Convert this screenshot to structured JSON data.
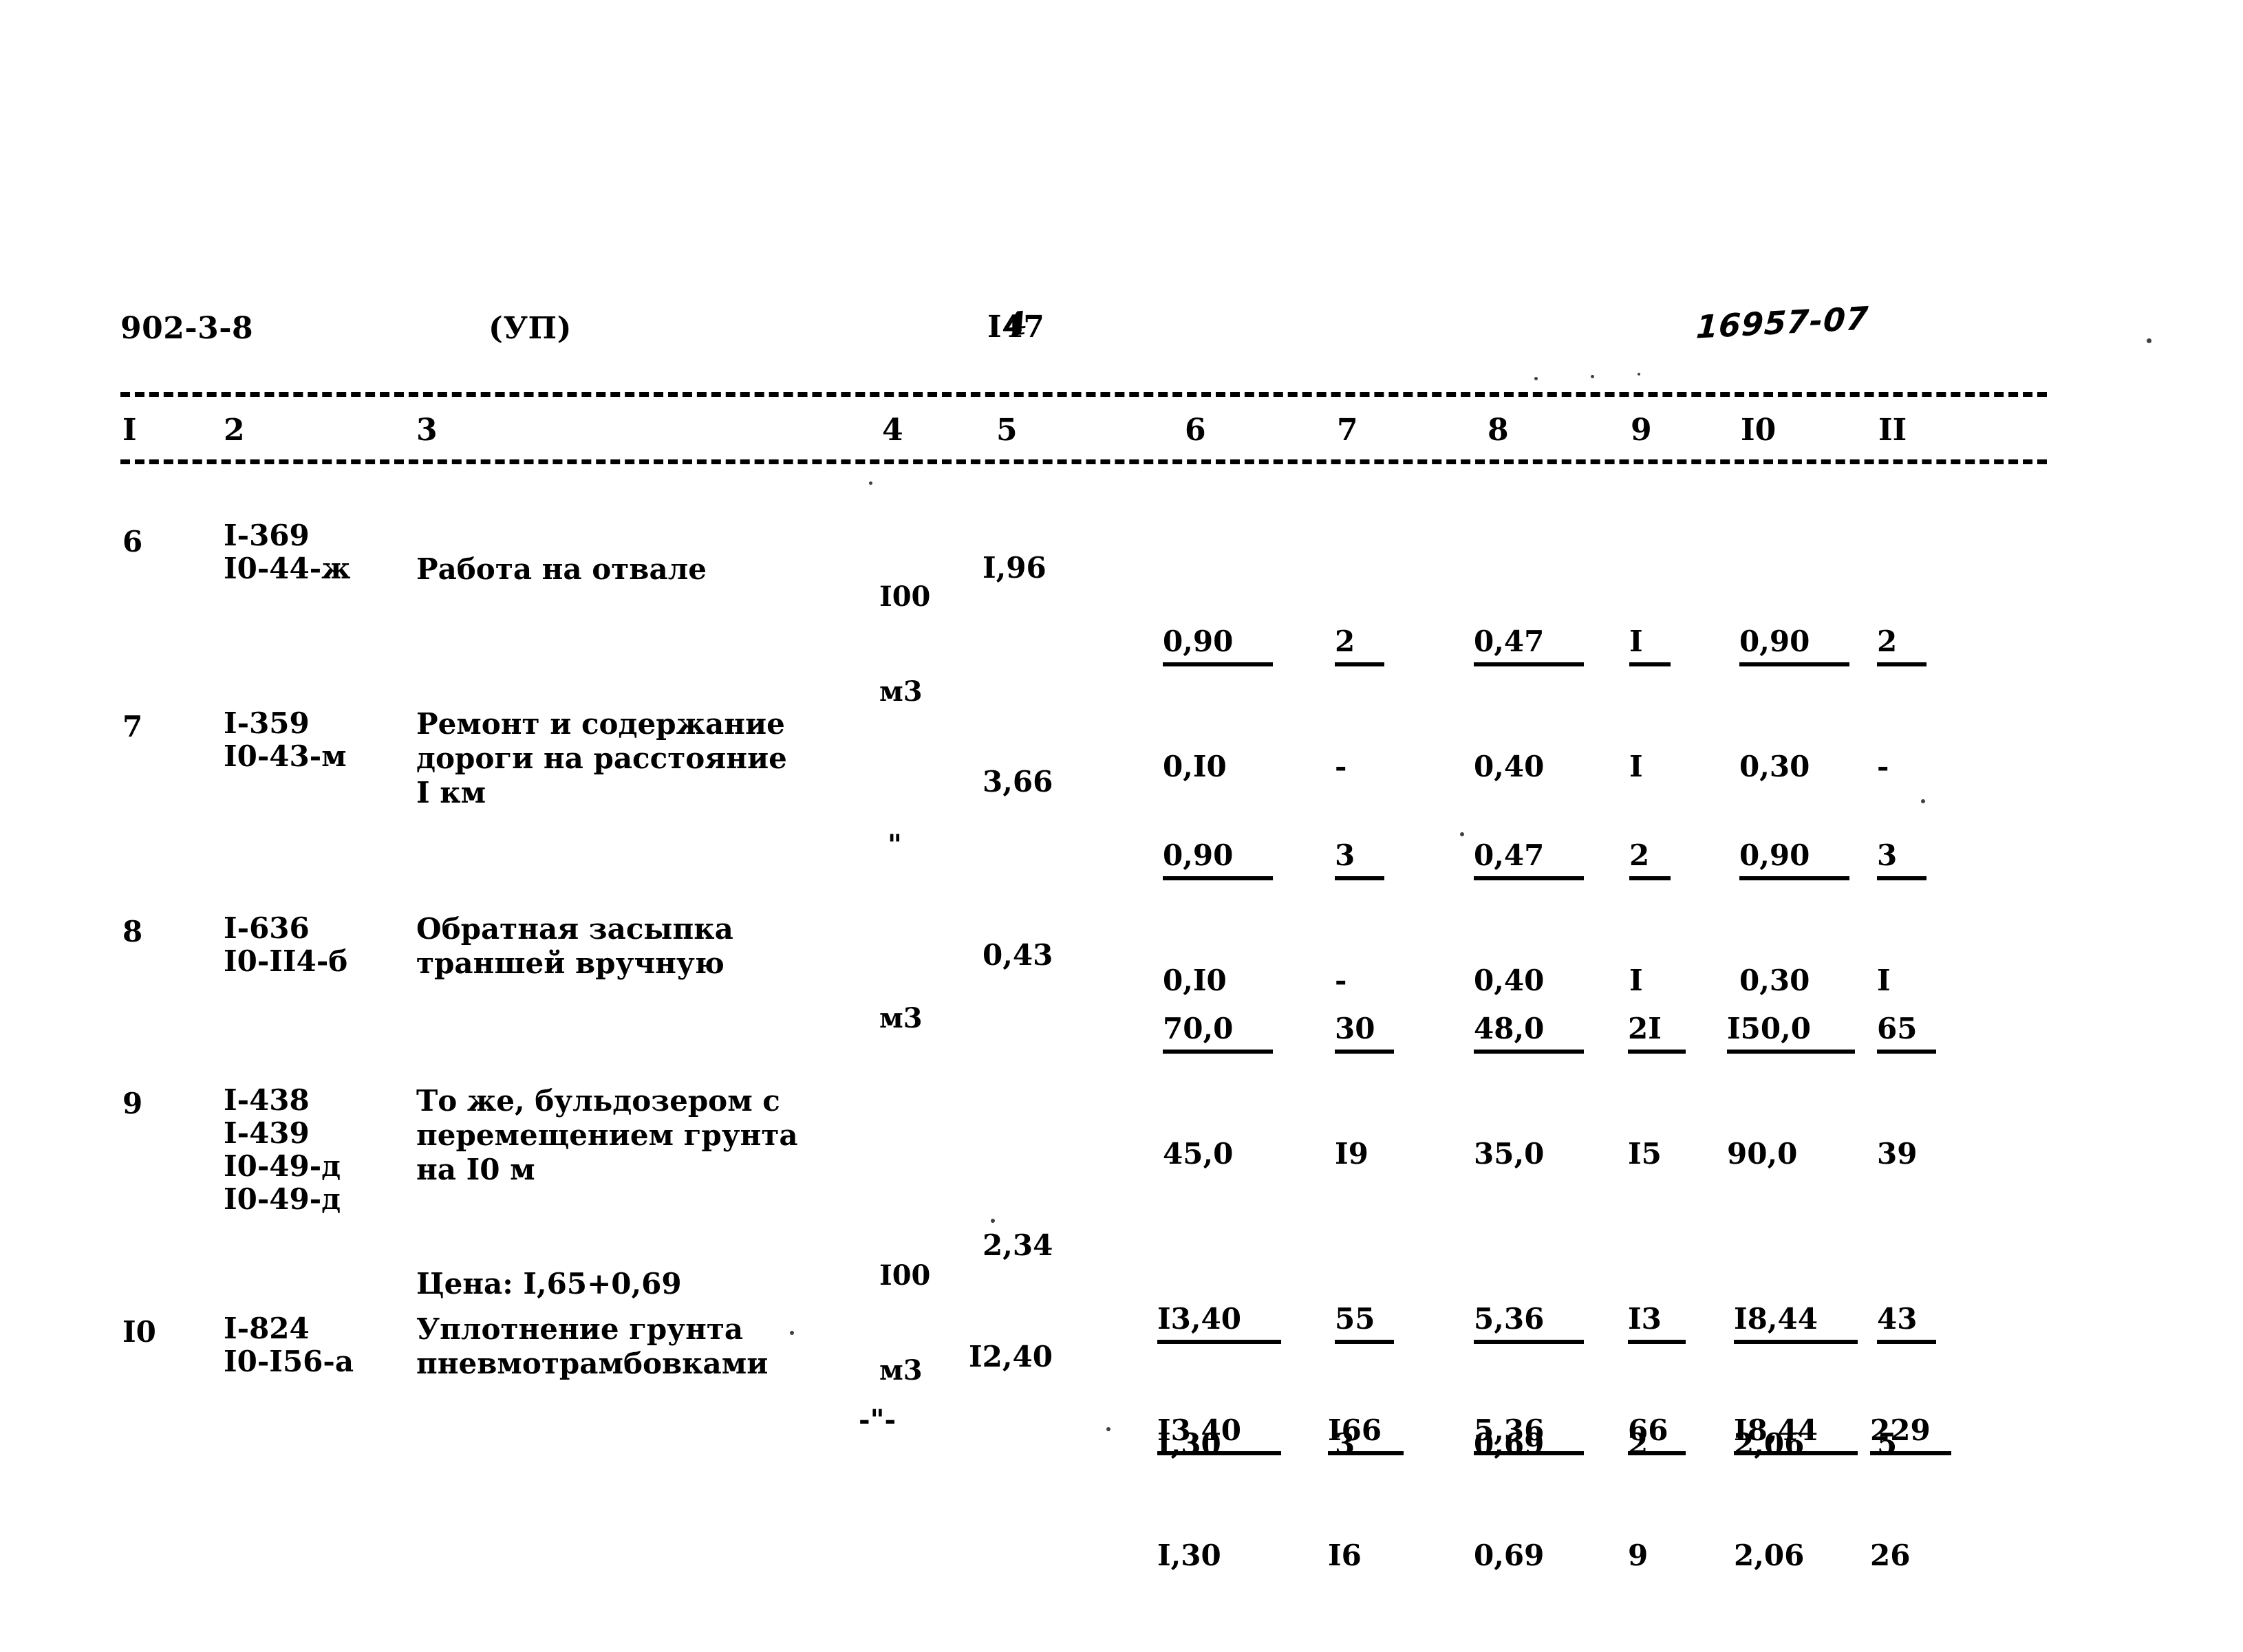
{
  "header": {
    "doc_code": "902-3-8",
    "series": "(УП)",
    "page_number": "I47",
    "page_number_handwritten": "4",
    "archive_stamp": "16957-07"
  },
  "table": {
    "column_headers": [
      "I",
      "2",
      "3",
      "4",
      "5",
      "6",
      "7",
      "8",
      "9",
      "I0",
      "II"
    ],
    "rows": [
      {
        "num": "6",
        "codes": [
          "I-369",
          "I0-44-ж"
        ],
        "description": [
          "Работа на отвале"
        ],
        "price_note": "",
        "unit": [
          "I00",
          "м3"
        ],
        "col5": "I,96",
        "col6": {
          "num": "0,90",
          "den": "0,I0"
        },
        "col7": {
          "num": "2",
          "den": "-"
        },
        "col8": {
          "num": "0,47",
          "den": "0,40"
        },
        "col9": {
          "num": "I",
          "den": "I"
        },
        "col10": {
          "num": "0,90",
          "den": "0,30"
        },
        "col11": {
          "num": "2",
          "den": "-"
        }
      },
      {
        "num": "7",
        "codes": [
          "I-359",
          "I0-43-м"
        ],
        "description": [
          "Ремонт и содержание",
          "дороги на расстояние",
          "I км"
        ],
        "price_note": "",
        "unit": [
          "\""
        ],
        "col5": "3,66",
        "col6": {
          "num": "0,90",
          "den": "0,I0"
        },
        "col7": {
          "num": "3",
          "den": "-"
        },
        "col8": {
          "num": "0,47",
          "den": "0,40"
        },
        "col9": {
          "num": "2",
          "den": "I"
        },
        "col10": {
          "num": "0,90",
          "den": "0,30"
        },
        "col11": {
          "num": "3",
          "den": "I"
        }
      },
      {
        "num": "8",
        "codes": [
          "I-636",
          "I0-II4-б"
        ],
        "description": [
          "Обратная засыпка",
          "траншей вручную"
        ],
        "price_note": "",
        "unit": [
          "м3"
        ],
        "col5": "0,43",
        "col6": {
          "num": "70,0",
          "den": "45,0"
        },
        "col7": {
          "num": "30",
          "den": "I9"
        },
        "col8": {
          "num": "48,0",
          "den": "35,0"
        },
        "col9": {
          "num": "2I",
          "den": "I5"
        },
        "col10": {
          "num": "I50,0",
          "den": "90,0"
        },
        "col11": {
          "num": "65",
          "den": "39"
        }
      },
      {
        "num": "9",
        "codes": [
          "I-438",
          "I-439",
          "I0-49-д",
          "I0-49-д"
        ],
        "description": [
          "То же, бульдозером с",
          "перемещением грунта",
          "на I0 м"
        ],
        "price_note": "Цена: I,65+0,69",
        "unit": [
          "I00",
          "м3"
        ],
        "col5": "2,34",
        "col6": {
          "num": "I3,40",
          "den": "I,30"
        },
        "col7": {
          "num": "55",
          "den": "3"
        },
        "col8": {
          "num": "5,36",
          "den": "0,69"
        },
        "col9": {
          "num": "I3",
          "den": "2"
        },
        "col10": {
          "num": "I8,44",
          "den": "2,06"
        },
        "col11": {
          "num": "43",
          "den": "5"
        }
      },
      {
        "num": "I0",
        "codes": [
          "I-824",
          "I0-I56-а"
        ],
        "description": [
          "Уплотнение грунта",
          "пневмотрамбовками"
        ],
        "price_note": "",
        "unit": [
          "-\"-"
        ],
        "col5": "I2,40",
        "col6": {
          "num": "I3,40",
          "den": "I,30"
        },
        "col7": {
          "num": "I66",
          "den": "I6"
        },
        "col8": {
          "num": "5,36",
          "den": "0,69"
        },
        "col9": {
          "num": "66",
          "den": "9"
        },
        "col10": {
          "num": "I8,44",
          "den": "2,06"
        },
        "col11": {
          "num": "229",
          "den": "26"
        }
      }
    ]
  }
}
